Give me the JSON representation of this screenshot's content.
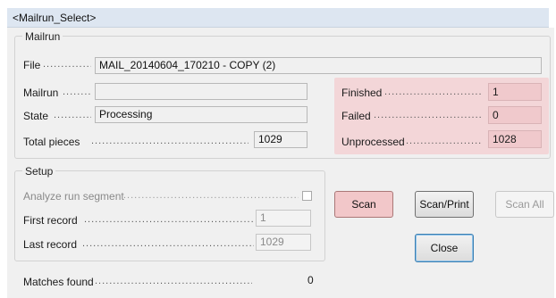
{
  "window": {
    "title": "<Mailrun_Select>"
  },
  "mailrun": {
    "legend": "Mailrun",
    "file_label": "File",
    "file_value": "MAIL_20140604_170210 - COPY (2)",
    "mailrun_label": "Mailrun",
    "mailrun_value": "",
    "state_label": "State",
    "state_value": "Processing",
    "total_label": "Total pieces",
    "total_value": "1029",
    "finished_label": "Finished",
    "finished_value": "1",
    "failed_label": "Failed",
    "failed_value": "0",
    "unprocessed_label": "Unprocessed",
    "unprocessed_value": "1028"
  },
  "setup": {
    "legend": "Setup",
    "analyze_label": "Analyze run segment",
    "first_label": "First record",
    "first_value": "1",
    "last_label": "Last record",
    "last_value": "1029"
  },
  "buttons": {
    "scan": "Scan",
    "scan_print": "Scan/Print",
    "scan_all": "Scan All",
    "close": "Close"
  },
  "matches": {
    "label": "Matches found",
    "value": "0"
  },
  "colors": {
    "highlight": "#f3d6d8",
    "titlebar": "#dde6f1"
  }
}
